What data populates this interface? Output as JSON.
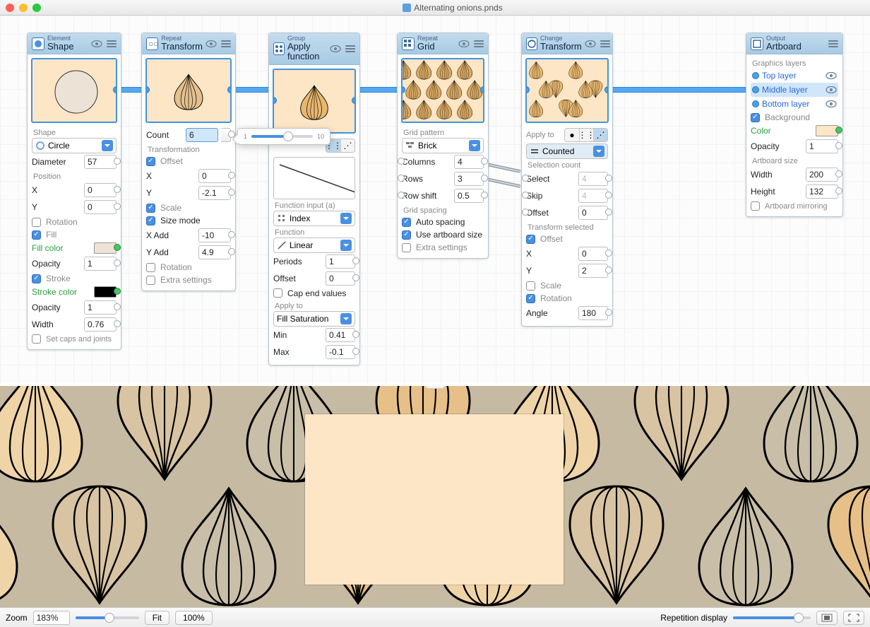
{
  "window": {
    "title": "Alternating onions.pnds"
  },
  "nodes": {
    "shape": {
      "kicker": "Element",
      "title": "Shape",
      "shape_select": "Circle",
      "diameter_label": "Diameter",
      "diameter": "57",
      "position_label": "Position",
      "x_label": "X",
      "x": "0",
      "y_label": "Y",
      "y": "0",
      "rotation_label": "Rotation",
      "fill_label": "Fill",
      "fillcolor_label": "Fill color",
      "fill_swatch": "#ece3d6",
      "opacity_label": "Opacity",
      "opacity": "1",
      "stroke_label": "Stroke",
      "strokecolor_label": "Stroke color",
      "stroke_swatch": "#000000",
      "stroke_opacity": "1",
      "width_label": "Width",
      "width": "0.76",
      "caps_label": "Set caps and joints"
    },
    "transform1": {
      "kicker": "Repeat",
      "title": "Transform",
      "count_label": "Count",
      "count": "6",
      "transformation_label": "Transformation",
      "offset_label": "Offset",
      "x_label": "X",
      "x": "0",
      "y_label": "Y",
      "y": "-2.1",
      "scale_label": "Scale",
      "sizemode_label": "Size mode",
      "xadd_label": "X Add",
      "xadd": "-10",
      "yadd_label": "Y Add",
      "yadd": "4.9",
      "rotation_label": "Rotation",
      "extra_label": "Extra settings",
      "popover_min": "1",
      "popover_max": "10"
    },
    "applyfn": {
      "kicker": "Group",
      "title": "Apply function",
      "funcinput_label": "Function input (a)",
      "funcinput_select": "Index",
      "function_label": "Function",
      "function_select": "Linear",
      "periods_label": "Periods",
      "periods": "1",
      "offset_label": "Offset",
      "offset": "0",
      "cap_label": "Cap end values",
      "applyto_label": "Apply to",
      "applyto_select": "Fill Saturation",
      "min_label": "Min",
      "min": "0.41",
      "max_label": "Max",
      "max": "-0.1"
    },
    "grid": {
      "kicker": "Repeat",
      "title": "Grid",
      "pattern_label": "Grid pattern",
      "pattern_select": "Brick",
      "columns_label": "Columns",
      "columns": "4",
      "rows_label": "Rows",
      "rows": "3",
      "rowshift_label": "Row shift",
      "rowshift": "0.5",
      "spacing_label": "Grid spacing",
      "auto_label": "Auto spacing",
      "useart_label": "Use artboard size",
      "extra_label": "Extra settings"
    },
    "transform2": {
      "kicker": "Change",
      "title": "Transform",
      "applyto_label": "Apply to",
      "mode_select": "Counted",
      "selcount_label": "Selection count",
      "select_label": "Select",
      "select": "4",
      "skip_label": "Skip",
      "skip": "4",
      "offset_label": "Offset",
      "offset": "0",
      "transsel_label": "Transform selected",
      "offset2_label": "Offset",
      "x_label": "X",
      "x": "0",
      "y_label": "Y",
      "y": "2",
      "scale_label": "Scale",
      "rotation_label": "Rotation",
      "angle_label": "Angle",
      "angle": "180"
    },
    "artboard": {
      "kicker": "Output",
      "title": "Artboard",
      "layers_label": "Graphics layers",
      "layers": [
        "Top layer",
        "Middle layer",
        "Bottom layer"
      ],
      "background_label": "Background",
      "color_label": "Color",
      "color_swatch": "#fce6c5",
      "opacity_label": "Opacity",
      "opacity": "1",
      "size_label": "Artboard size",
      "width_label": "Width",
      "width": "200",
      "height_label": "Height",
      "height": "132",
      "mirror_label": "Artboard mirroring"
    }
  },
  "status": {
    "zoom_label": "Zoom",
    "zoom_value": "183%",
    "fit_label": "Fit",
    "hundred": "100%",
    "rep_label": "Repetition display"
  }
}
